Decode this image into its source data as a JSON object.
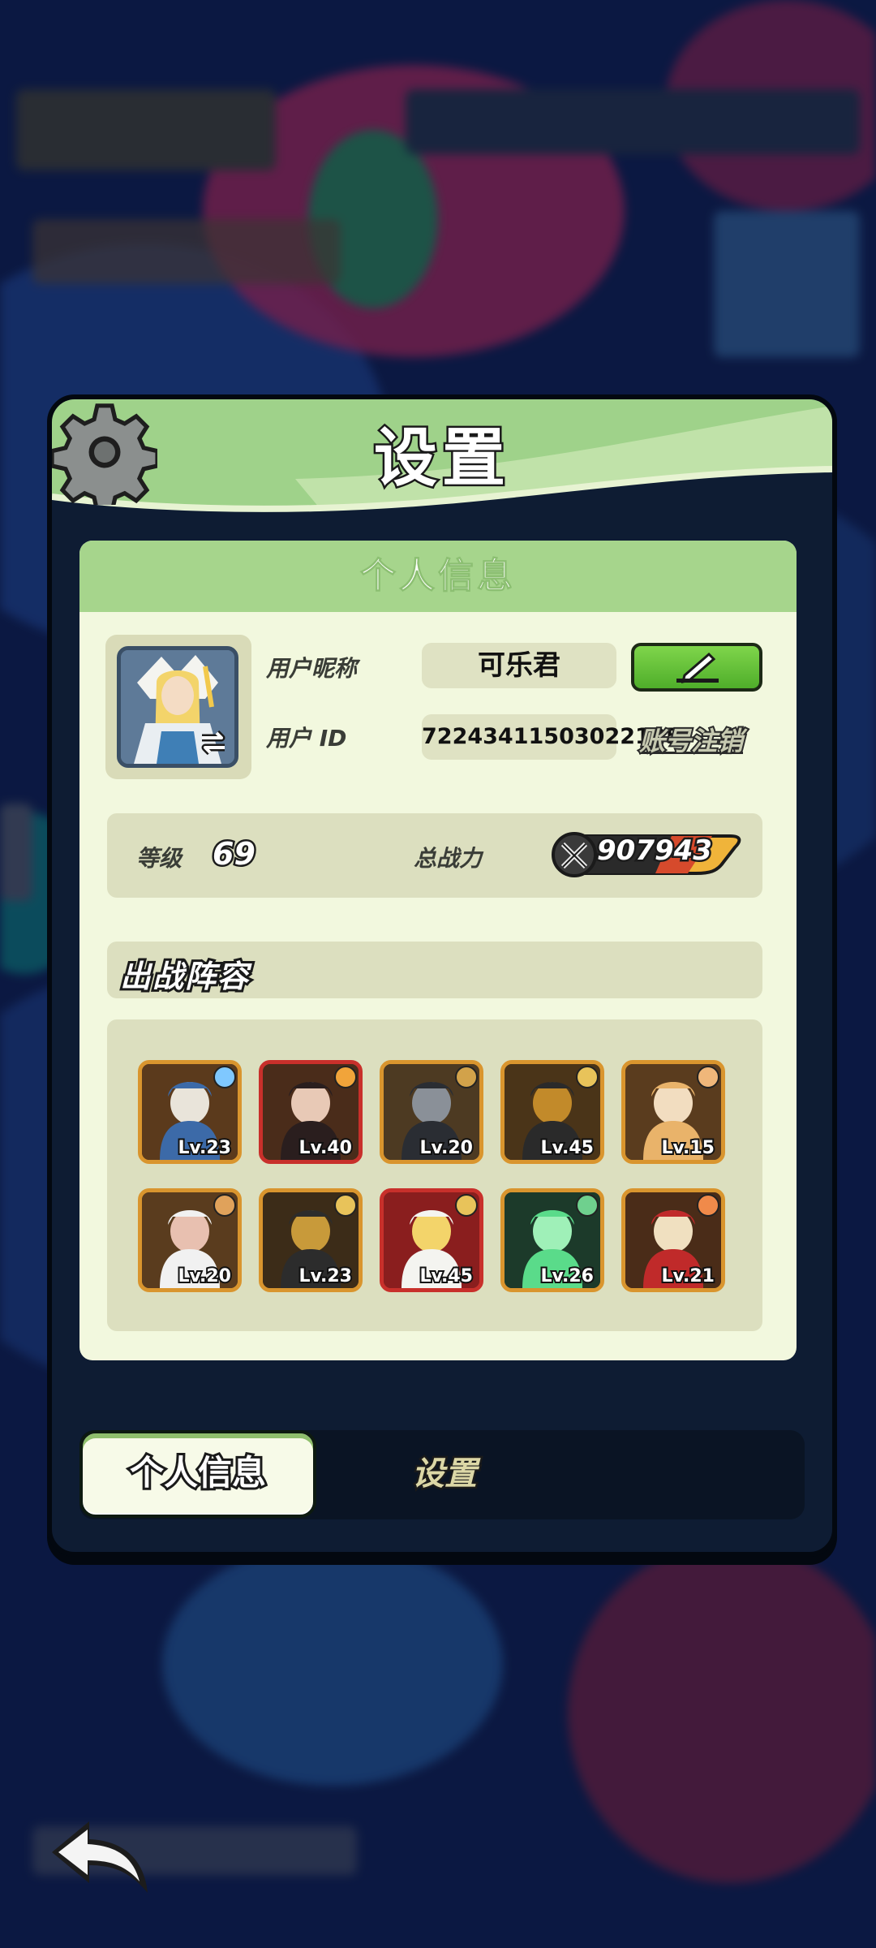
{
  "dialog": {
    "title": "设置",
    "section_title": "个人信息"
  },
  "profile": {
    "nickname_label": "用户昵称",
    "nickname": "可乐君",
    "id_label": "用户 ID",
    "user_id": "72243411503022125",
    "cancel_account_label": "账号注销"
  },
  "stats": {
    "level_label": "等级",
    "level": "69",
    "power_label": "总战力",
    "power": "907943"
  },
  "lineup": {
    "title": "出战阵容",
    "heroes": [
      {
        "level": "Lv.23",
        "frame": "gold",
        "element_color": "#7fc8ff"
      },
      {
        "level": "Lv.40",
        "frame": "red",
        "element_color": "#f1a43a"
      },
      {
        "level": "Lv.20",
        "frame": "gold",
        "element_color": "#d2a24a"
      },
      {
        "level": "Lv.45",
        "frame": "gold",
        "element_color": "#e8c35a"
      },
      {
        "level": "Lv.15",
        "frame": "gold",
        "element_color": "#f0b77a"
      },
      {
        "level": "Lv.20",
        "frame": "gold",
        "element_color": "#e0a25b"
      },
      {
        "level": "Lv.23",
        "frame": "gold",
        "element_color": "#e8c35a"
      },
      {
        "level": "Lv.45",
        "frame": "red",
        "element_color": "#e8c35a"
      },
      {
        "level": "Lv.26",
        "frame": "gold",
        "element_color": "#6fd08e"
      },
      {
        "level": "Lv.21",
        "frame": "gold",
        "element_color": "#f08a4a"
      }
    ]
  },
  "tabs": [
    {
      "label": "个人信息",
      "active": true
    },
    {
      "label": "设置",
      "active": false
    }
  ],
  "colors": {
    "header_green": "#9fd28a",
    "content_bg": "#f2f8de",
    "edit_button": "#5fc236",
    "hero_frame_gold": "#d9952e",
    "hero_frame_red": "#c8302b"
  },
  "icons": [
    "gear-icon",
    "swap-icon",
    "pencil-icon",
    "crossed-swords-icon",
    "back-arrow-icon"
  ]
}
